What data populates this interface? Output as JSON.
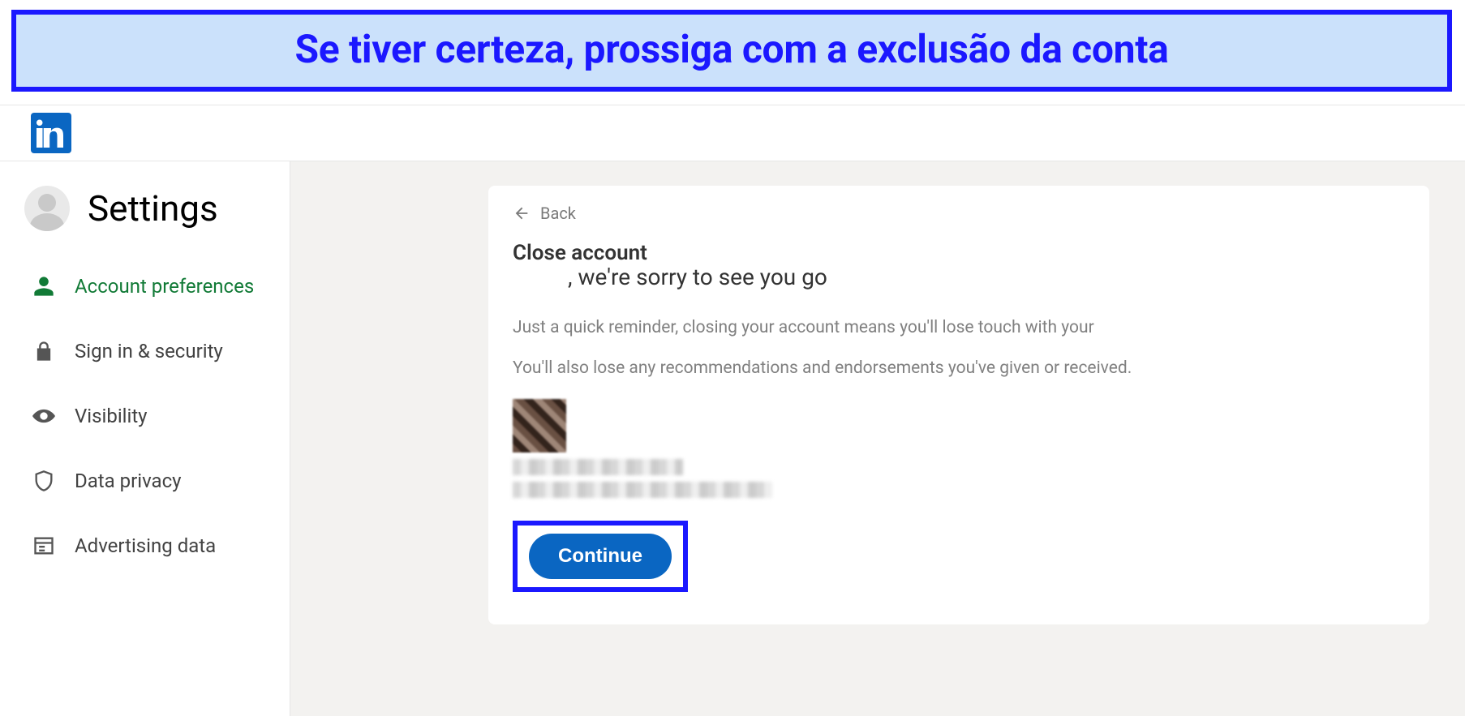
{
  "banner": {
    "text": "Se tiver certeza, prossiga com a exclusão da conta"
  },
  "logo": {
    "name": "linkedin-logo"
  },
  "settings_title": "Settings",
  "sidebar": {
    "items": [
      {
        "label": "Account preferences",
        "active": true,
        "icon": "person-icon"
      },
      {
        "label": "Sign in & security",
        "active": false,
        "icon": "lock-icon"
      },
      {
        "label": "Visibility",
        "active": false,
        "icon": "eye-icon"
      },
      {
        "label": "Data privacy",
        "active": false,
        "icon": "shield-icon"
      },
      {
        "label": "Advertising data",
        "active": false,
        "icon": "newspaper-icon"
      }
    ]
  },
  "main": {
    "back_label": "Back",
    "title": "Close account",
    "subtitle": ", we're sorry to see you go",
    "paragraph1": "Just a quick reminder, closing your account means you'll lose touch with your",
    "paragraph2": "You'll also lose any recommendations and endorsements you've given or received.",
    "continue_label": "Continue"
  },
  "colors": {
    "accent_blue": "#0a66c2",
    "highlight_blue": "#1b18ff",
    "banner_bg": "#cbe1fb",
    "active_green": "#117a36"
  }
}
